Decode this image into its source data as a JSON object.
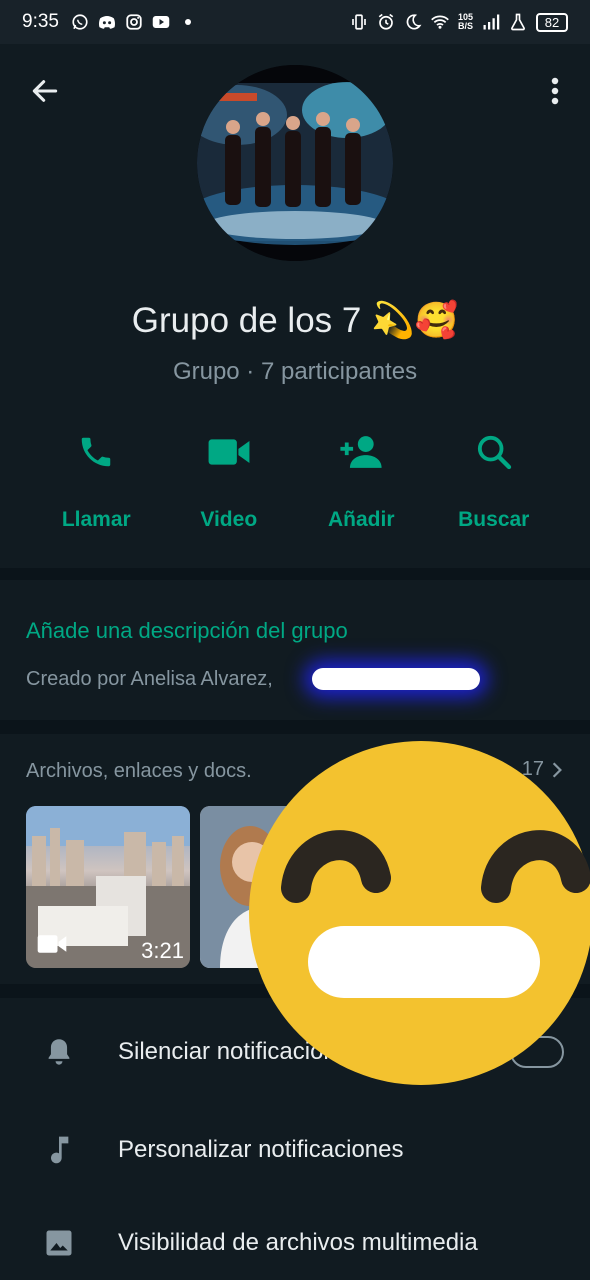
{
  "status_bar": {
    "time": "9:35",
    "left_icons": [
      "whatsapp-icon",
      "discord-icon",
      "instagram-icon",
      "youtube-icon",
      "dot-icon"
    ],
    "right_icons": [
      "vibrate-icon",
      "alarm-icon",
      "moon-icon",
      "wifi-icon",
      "signal-icon",
      "flask-icon"
    ],
    "net_speed_value": "105",
    "net_speed_unit": "B/S",
    "battery": "82"
  },
  "header": {
    "group_name": "Grupo de los 7 💫🥰",
    "subtitle": "Grupo · 7 participantes"
  },
  "actions": [
    {
      "label": "Llamar",
      "icon": "phone-icon"
    },
    {
      "label": "Video",
      "icon": "video-icon"
    },
    {
      "label": "Añadir",
      "icon": "add-person-icon"
    },
    {
      "label": "Buscar",
      "icon": "search-icon"
    }
  ],
  "description": {
    "add_text": "Añade una descripción del grupo",
    "created_by": "Creado por Anelisa Alvarez,"
  },
  "media": {
    "title": "Archivos, enlaces y docs.",
    "count": "17",
    "thumbnails": [
      {
        "duration": "3:21",
        "type": "video"
      },
      {
        "duration": "",
        "type": "image"
      }
    ]
  },
  "settings": [
    {
      "label": "Silenciar notificaciones",
      "icon": "bell-icon"
    },
    {
      "label": "Personalizar notificaciones",
      "icon": "music-note-icon"
    },
    {
      "label": "Visibilidad de archivos multimedia",
      "icon": "image-icon"
    }
  ],
  "colors": {
    "accent": "#00a884",
    "background": "#0b141a",
    "panel": "#111b21",
    "secondary_text": "#8696a0",
    "sticker": "#f3c22f"
  }
}
